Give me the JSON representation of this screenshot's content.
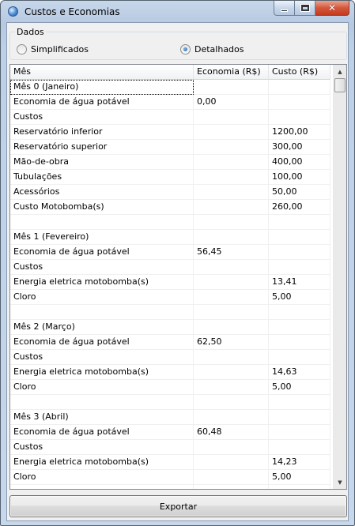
{
  "window": {
    "title": "Custos e Economias"
  },
  "dados": {
    "legend": "Dados",
    "options": [
      {
        "label": "Simplificados",
        "checked": false
      },
      {
        "label": "Detalhados",
        "checked": true
      }
    ]
  },
  "table": {
    "columns": [
      "Mês",
      "Economia (R$)",
      "Custo (R$)"
    ],
    "rows": [
      [
        "Mês 0 (Janeiro)",
        "",
        ""
      ],
      [
        "Economia de água potável",
        "0,00",
        ""
      ],
      [
        "Custos",
        "",
        ""
      ],
      [
        "Reservatório inferior",
        "",
        "1200,00"
      ],
      [
        "Reservatório superior",
        "",
        "300,00"
      ],
      [
        "Mão-de-obra",
        "",
        "400,00"
      ],
      [
        "Tubulações",
        "",
        "100,00"
      ],
      [
        "Acessórios",
        "",
        "50,00"
      ],
      [
        "Custo Motobomba(s)",
        "",
        "260,00"
      ],
      [
        "",
        "",
        ""
      ],
      [
        "Mês 1 (Fevereiro)",
        "",
        ""
      ],
      [
        "Economia de água potável",
        "56,45",
        ""
      ],
      [
        "Custos",
        "",
        ""
      ],
      [
        "Energia eletrica motobomba(s)",
        "",
        "13,41"
      ],
      [
        "Cloro",
        "",
        "5,00"
      ],
      [
        "",
        "",
        ""
      ],
      [
        "Mês 2 (Março)",
        "",
        ""
      ],
      [
        "Economia de água potável",
        "62,50",
        ""
      ],
      [
        "Custos",
        "",
        ""
      ],
      [
        "Energia eletrica motobomba(s)",
        "",
        "14,63"
      ],
      [
        "Cloro",
        "",
        "5,00"
      ],
      [
        "",
        "",
        ""
      ],
      [
        "Mês 3 (Abril)",
        "",
        ""
      ],
      [
        "Economia de água potável",
        "60,48",
        ""
      ],
      [
        "Custos",
        "",
        ""
      ],
      [
        "Energia eletrica motobomba(s)",
        "",
        "14,23"
      ],
      [
        "Cloro",
        "",
        "5,00"
      ],
      [
        "",
        "",
        ""
      ]
    ]
  },
  "export_label": "Exportar",
  "icons": {
    "window": "app-icon",
    "minimize": "minimize-icon",
    "maximize": "maximize-icon",
    "close": "close-icon",
    "scroll_up": "scroll-up-arrow-icon",
    "scroll_down": "scroll-down-arrow-icon"
  },
  "colors": {
    "title_gradient": "#b6c9e2",
    "close_button": "#d4583c",
    "client_bg": "#f0f0f0"
  }
}
